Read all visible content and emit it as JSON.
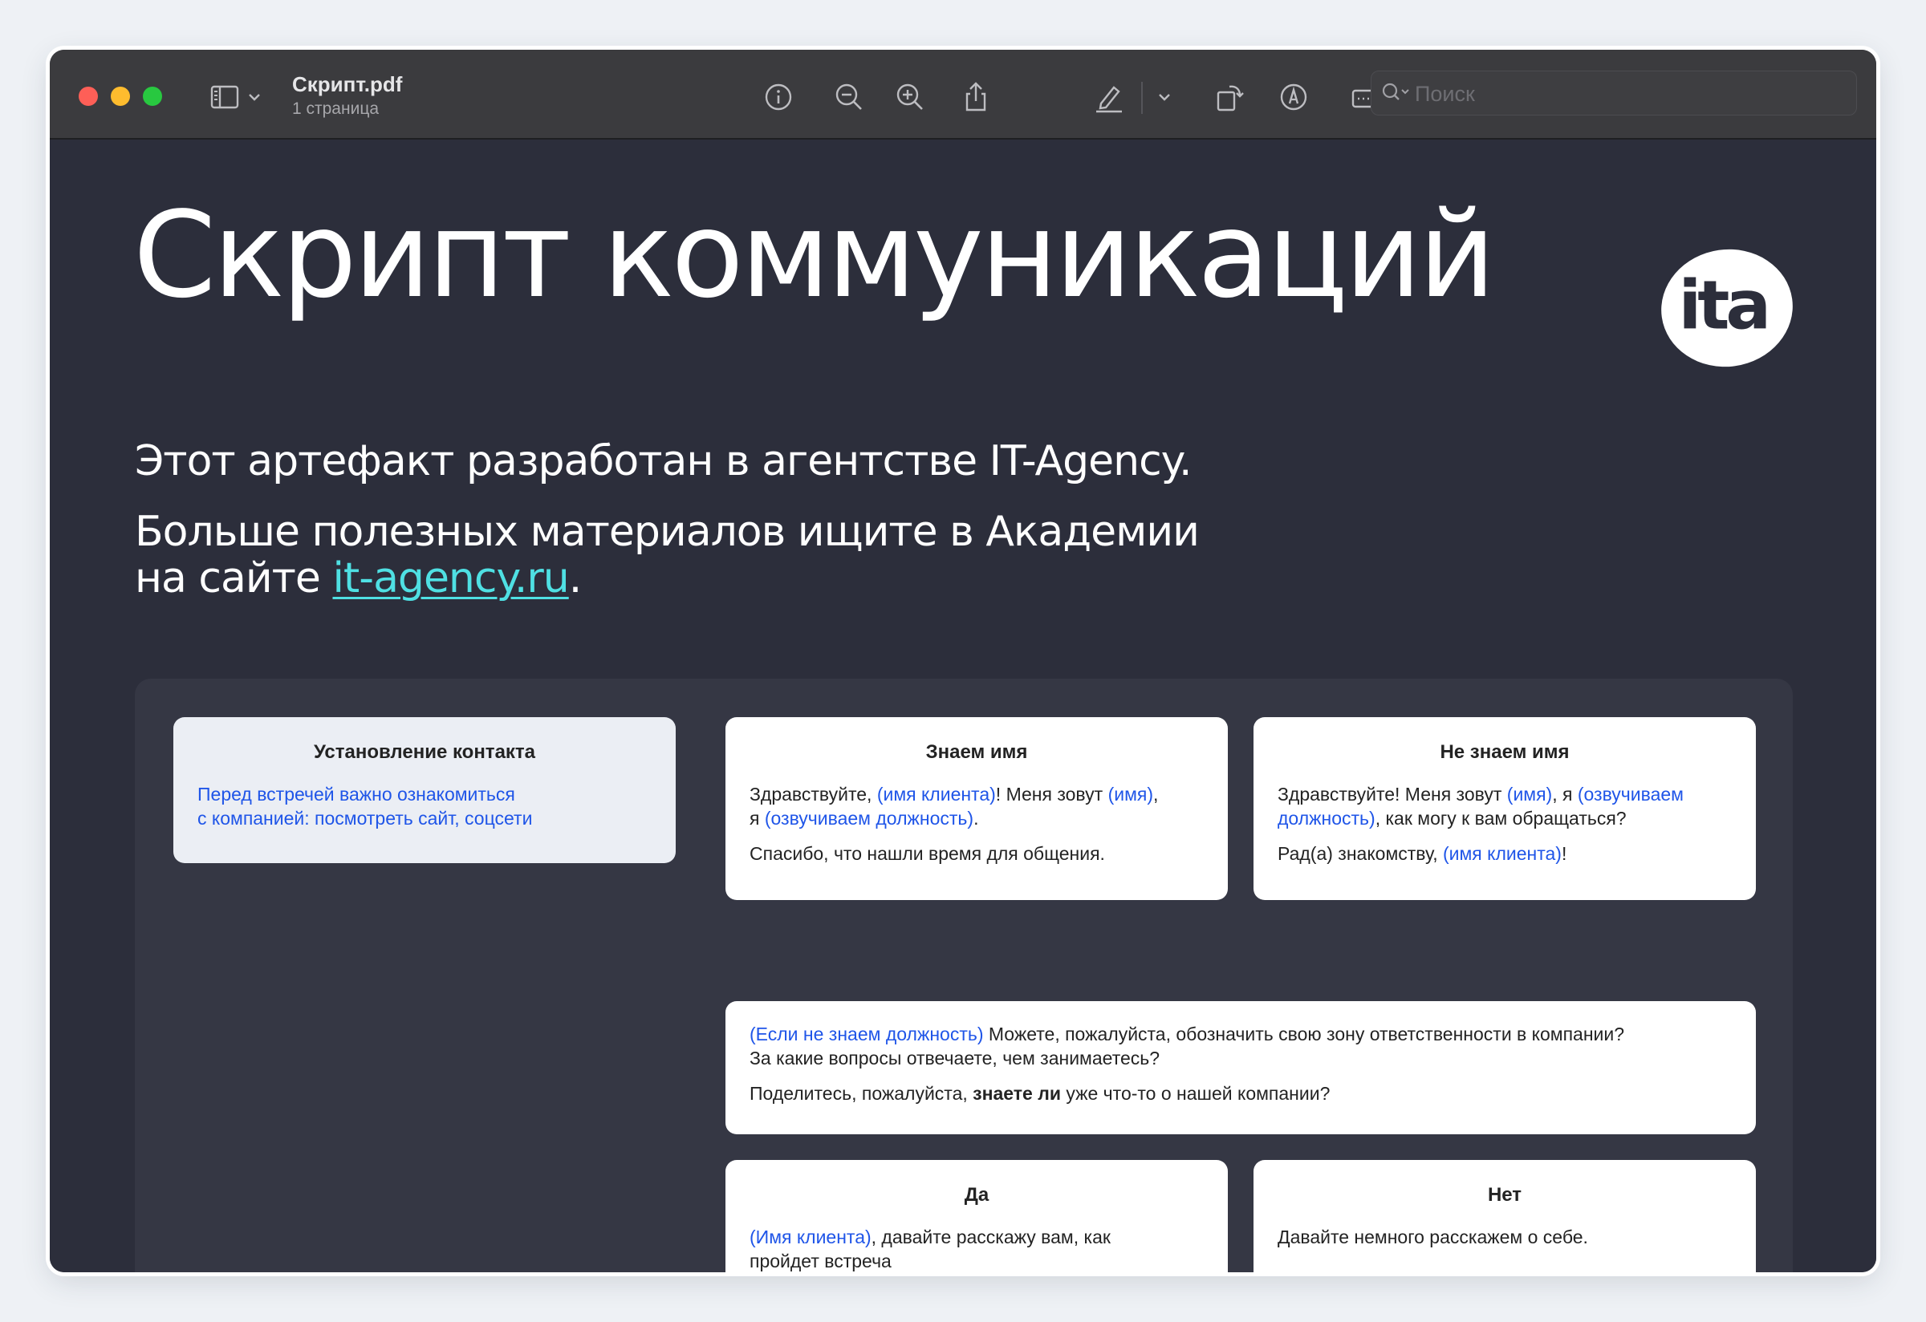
{
  "window": {
    "title": "Скрипт.pdf",
    "subtitle": "1 страница",
    "search_placeholder": "Поиск"
  },
  "toolbar": {
    "icons": [
      "sidebar-icon",
      "chevron-down-icon",
      "info-icon",
      "zoom-out-icon",
      "zoom-in-icon",
      "share-icon",
      "highlight-pen-icon",
      "chevron-down-icon",
      "rotate-icon",
      "markup-icon",
      "form-fill-icon",
      "search-icon"
    ]
  },
  "document": {
    "heading": "Скрипт коммуникаций",
    "logo_text": "ita",
    "intro_line1": "Этот артефакт разработан в агентстве IT-Agency.",
    "intro_line2": "Больше полезных материалов ищите в Академии",
    "intro_line3_prefix": "на сайте ",
    "intro_link": "it-agency.ru",
    "intro_line3_suffix": "."
  },
  "cards": {
    "contact": {
      "title": "Установление контакта",
      "line1": "Перед встречей важно ознакомиться",
      "line2": "с компанией: посмотреть сайт, соцсети"
    },
    "know_name": {
      "title": "Знаем имя",
      "p1_a": "Здравствуйте, ",
      "p1_b": "(имя клиента)",
      "p1_c": "! Меня зовут ",
      "p1_d": "(имя)",
      "p1_e": ",",
      "p1_f": "я ",
      "p1_g": "(озвучиваем должность)",
      "p1_h": ".",
      "p2": "Спасибо, что нашли время для общения."
    },
    "unknown_name": {
      "title": "Не знаем имя",
      "p1_a": "Здравствуйте! Меня зовут ",
      "p1_b": "(имя)",
      "p1_c": ", я ",
      "p1_d": "(озвучиваем",
      "p1_e": "должность)",
      "p1_f": ", как могу к вам обращаться?",
      "p2_a": "Рад(а) знакомству, ",
      "p2_b": "(имя клиента)",
      "p2_c": "!"
    },
    "position": {
      "p1_a": "(Если не знаем должность)",
      "p1_b": " Можете, пожалуйста, обозначить свою зону ответственности в компании?",
      "p1_c": "За какие вопросы отвечаете, чем занимаетесь?",
      "p2_a": "Поделитесь, пожалуйста, ",
      "p2_b": "знаете ли",
      "p2_c": " уже что-то о нашей компании?"
    },
    "yes": {
      "title": "Да",
      "p1_a": "(Имя клиента)",
      "p1_b": ", давайте расскажу вам, как",
      "p1_c": "пройдет встреча"
    },
    "no": {
      "title": "Нет",
      "p1": "Давайте немного расскажем о себе."
    }
  }
}
